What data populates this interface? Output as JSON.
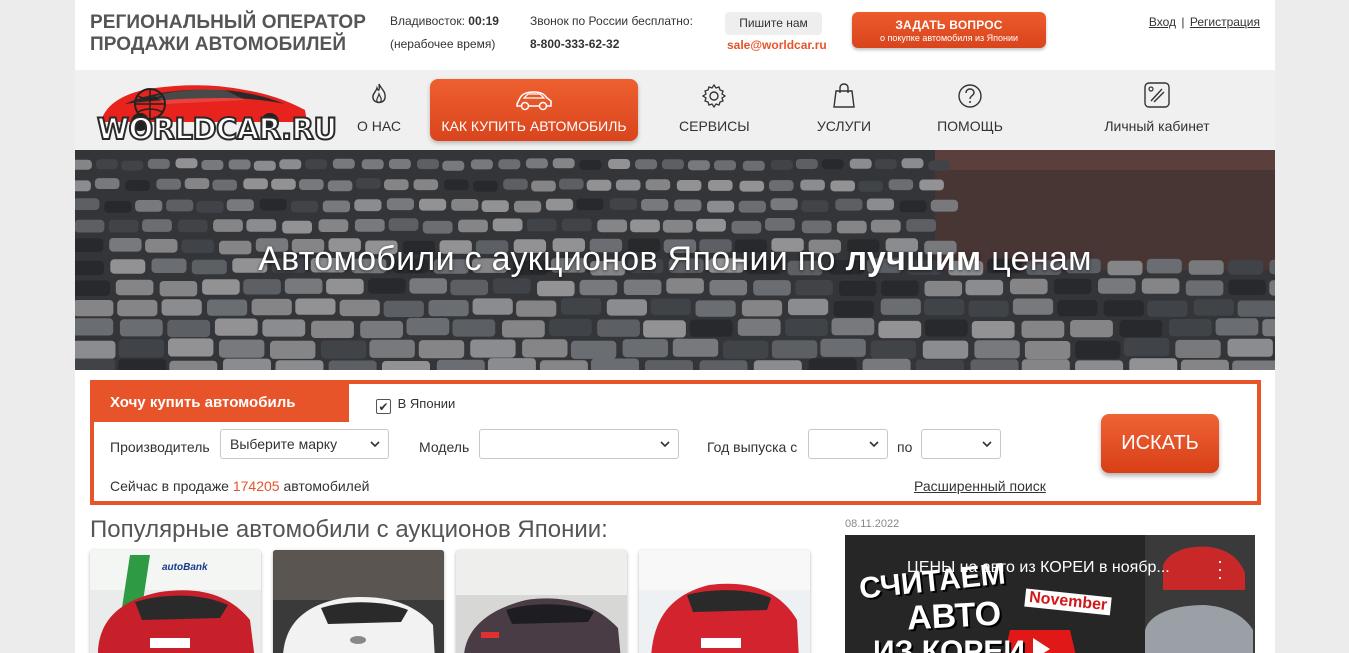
{
  "header": {
    "brand_line1": "РЕГИОНАЛЬНЫЙ ОПЕРАТОР",
    "brand_line2": "ПРОДАЖИ АВТОМОБИЛЕЙ",
    "city_label": "Владивосток:",
    "city_time": "00:19",
    "city_note": "(нерабочее время)",
    "hotline_label": "Звонок по России бесплатно:",
    "phone": "8-800-333-62-32",
    "write_label": "Пишите нам",
    "email": "sale@worldcar.ru",
    "ask_label": "ЗАДАТЬ ВОПРОС",
    "ask_sub": "о покупке автомобиля из Японии",
    "login": "Вход",
    "separator": "|",
    "register": "Регистрация"
  },
  "logo": {
    "text": "WORLDCAR.RU"
  },
  "nav": {
    "about": {
      "label": "О НАС",
      "icon": "fire-icon"
    },
    "how_to_buy": {
      "label": "КАК КУПИТЬ АВТОМОБИЛЬ",
      "icon": "car-icon"
    },
    "services": {
      "label": "СЕРВИСЫ",
      "icon": "gear-icon"
    },
    "offers": {
      "label": "УСЛУГИ",
      "icon": "shopping-bag-icon"
    },
    "help": {
      "label": "ПОМОЩЬ",
      "icon": "question-icon"
    },
    "cabinet": {
      "label": "Личный кабинет",
      "icon": "cabinet-icon"
    }
  },
  "hero": {
    "title_part1": "Автомобили с аукционов Японии по ",
    "title_bold": "лучшим",
    "title_part2": " ценам"
  },
  "search": {
    "tab_label": "Хочу купить автомобиль",
    "checkbox_label": "В Японии",
    "checkbox_checked": true,
    "maker_label": "Производитель",
    "maker_value": "Выберите марку",
    "model_label": "Модель",
    "model_value": "",
    "year_from_label": "Год выпуска с",
    "year_from_value": "",
    "year_to_label": "по",
    "year_to_value": "",
    "submit_label": "ИСКАТЬ",
    "sale_prefix": "Сейчас в продаже",
    "sale_count": "174205",
    "sale_suffix": "автомобилей",
    "advanced_label": "Расширенный поиск"
  },
  "popular": {
    "title": "Популярные автомобили с аукционов Японии:",
    "cars": [
      {
        "color": "#c8202a",
        "label": "autoBank"
      },
      {
        "color": "#f2f2f2",
        "label": ""
      },
      {
        "color": "#4a3c45",
        "label": ""
      },
      {
        "color": "#d2232e",
        "label": ""
      }
    ]
  },
  "video": {
    "date": "08.11.2022",
    "title": "ЦЕНЫ на авто из КОРЕИ в ноябр...",
    "overlay_line1": "СЧИТАЕМ",
    "overlay_line2": "АВТО",
    "overlay_badge": "November",
    "overlay_line3": "ИЗ КОРЕИ"
  },
  "colors": {
    "accent": "#e8542a",
    "nav_bg": "#f0f0f0"
  }
}
